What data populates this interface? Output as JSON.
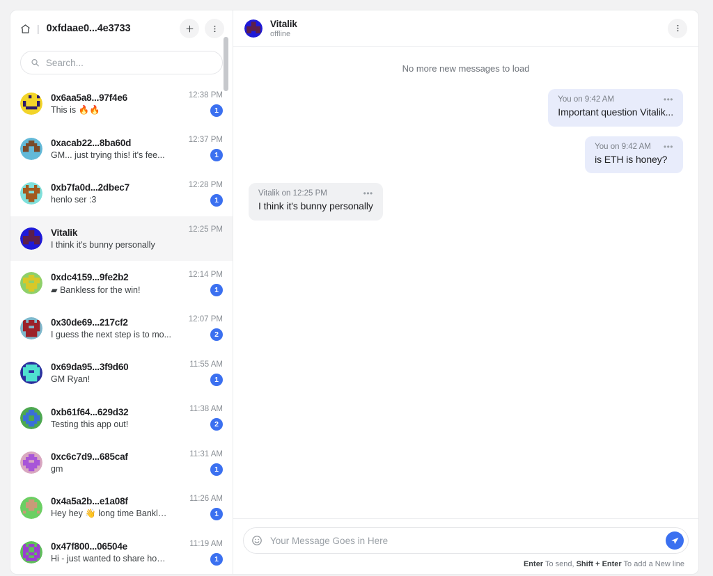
{
  "sidebar": {
    "header": {
      "home_icon": "home-icon",
      "separator": "|",
      "wallet_id": "0xfdaae0...4e3733",
      "add_label": "+",
      "menu_label": "more-vertical"
    },
    "search": {
      "placeholder": "Search...",
      "value": "",
      "icon": "search-icon"
    },
    "conversations": [
      {
        "name": "0x6aa5a8...97f4e6",
        "preview": "This is 🔥🔥",
        "time": "12:38 PM",
        "unread": "1",
        "active": false,
        "avatar": {
          "bg": "#f2d42a",
          "fg": "#2b1a6b",
          "cells": "0000000000111100011111100111111001011010011111100011110000000000",
          "cells2": "0000000000010010000000000100001001000010001111000000000000000000"
        }
      },
      {
        "name": "0xacab22...8ba60d",
        "preview": "GM... just trying this! it's fee...",
        "time": "12:37 PM",
        "unread": "1",
        "active": false,
        "avatar": {
          "bg": "#63b9d8",
          "fg": "#7a4a2a",
          "cells": "0000000000111100011111100111111001111110011111100011110000000000",
          "cells2": "0000000000011000001111000110011001100110000000000000000000000000"
        }
      },
      {
        "name": "0xb7fa0d...2dbec7",
        "preview": "henlo ser :3",
        "time": "12:28 PM",
        "unread": "1",
        "active": false,
        "avatar": {
          "bg": "#7fe0db",
          "fg": "#a35a1e",
          "cells": "0000000000111100011111100111111001111110011111100011110000000000",
          "cells2": "0000000000100100011111100110011000111100001111000001100000000000"
        }
      },
      {
        "name": "Vitalik",
        "preview": "I think it's bunny personally",
        "time": "12:25 PM",
        "unread": "",
        "active": true,
        "avatar": {
          "bg": "#1f1ad8",
          "fg": "#5c1f4a",
          "cells": "0000000000111100011111100111111001111110011111100011110000000000",
          "cells2": "0000000000011000000110000111111001111110011001100000000000000000"
        }
      },
      {
        "name": "0xdc4159...9fe2b2",
        "preview": "▰ Bankless for the win!",
        "time": "12:14 PM",
        "unread": "1",
        "active": false,
        "avatar": {
          "bg": "#8ed06a",
          "fg": "#d8c828",
          "cells": "0000000000111100011111100111111001111110011111100011110000000000",
          "cells2": "0000000000011000011111100110011000111100001111000001100000000000"
        }
      },
      {
        "name": "0x30de69...217cf2",
        "preview": "I guess the next step is to mo...",
        "time": "12:07 PM",
        "unread": "2",
        "active": false,
        "avatar": {
          "bg": "#7fb8cc",
          "fg": "#9c2229",
          "cells": "0000000000111100011111100111111001111110011111100011110000000000",
          "cells2": "0000000001011010011111100110011001111110001111000011110000000000"
        }
      },
      {
        "name": "0x69da95...3f9d60",
        "preview": "GM Ryan!",
        "time": "11:55 AM",
        "unread": "1",
        "active": false,
        "avatar": {
          "bg": "#2b2f9e",
          "fg": "#4fe0cf",
          "cells": "0000000000111100011111100111111001111110011111100011110000000000",
          "cells2": "0000000000111100011111100110011001111110001111000011110000000000"
        }
      },
      {
        "name": "0xb61f64...629d32",
        "preview": "Testing this app out!",
        "time": "11:38 AM",
        "unread": "2",
        "active": false,
        "avatar": {
          "bg": "#4da84f",
          "fg": "#3a6fd8",
          "cells": "0000000000111100011111100111111001111110011111100011110000000000",
          "cells2": "0000000000011000001111000110011001100110001111000001100000000000"
        }
      },
      {
        "name": "0xc6c7d9...685caf",
        "preview": "gm",
        "time": "11:31 AM",
        "unread": "1",
        "active": false,
        "avatar": {
          "bg": "#d9a8c0",
          "fg": "#a855d8",
          "cells": "0000000000111100011111100111111001111110011111100011110000000000",
          "cells2": "0000000000011000001111000110011001111110001111000001100000000000"
        }
      },
      {
        "name": "0x4a5a2b...e1a08f",
        "preview": "Hey hey 👋 long time Bankless ...",
        "time": "11:26 AM",
        "unread": "1",
        "active": false,
        "avatar": {
          "bg": "#6bcf63",
          "fg": "#c99a78",
          "cells": "0000000000111100011111100111111001111110011111100011110000000000",
          "cells2": "0000000000011000001111000011110000011000010000100000000000000000"
        }
      },
      {
        "name": "0x47f800...06504e",
        "preview": "Hi - just wanted to share how ...",
        "time": "11:19 AM",
        "unread": "1",
        "active": false,
        "avatar": {
          "bg": "#5fbf5a",
          "fg": "#9a3fcf",
          "cells": "0000000000111100011111100111111001111110011111100011110000000000",
          "cells2": "0000000001011010011001100110011001011010011001100011110000000000"
        }
      }
    ]
  },
  "chat": {
    "header": {
      "name": "Vitalik",
      "status": "offline",
      "menu_label": "more-vertical",
      "avatar": {
        "bg": "#1f1ad8",
        "fg": "#5c1f4a",
        "cells": "0000000000111100011111100111111001111110011111100011110000000000",
        "cells2": "0000000000011000000110000111111001111110011001100000000000000000"
      }
    },
    "load_notice": "No more new messages to load",
    "messages": [
      {
        "side": "out",
        "meta": "You on 9:42 AM",
        "dots": "•••",
        "text": "Important question Vitalik..."
      },
      {
        "side": "out",
        "meta": "You on 9:42 AM",
        "dots": "•••",
        "text": "is ETH is honey?"
      },
      {
        "side": "in",
        "meta": "Vitalik on 12:25 PM",
        "dots": "•••",
        "text": "I think it's bunny personally"
      }
    ],
    "composer": {
      "placeholder": "Your Message Goes in Here",
      "value": "",
      "emoji_icon": "emoji-smiley-icon",
      "send_icon": "send-paper-plane-icon"
    },
    "hint": {
      "enter": "Enter",
      "enter_tail": " To send, ",
      "shift": "Shift + Enter",
      "shift_tail": " To add a New line"
    }
  },
  "colors": {
    "accent": "#3b70f0",
    "outgoing_bubble": "#e8ecfb",
    "incoming_bubble": "#f0f1f3",
    "page_bg": "#f2f2f3",
    "panel_bg": "#ffffff",
    "active_row": "#f5f5f6"
  }
}
